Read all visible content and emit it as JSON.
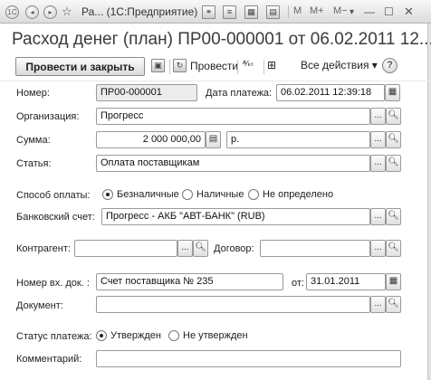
{
  "titlebar": {
    "app_icon": "1c-logo-icon",
    "title": "Ра...  (1С:Предприятие)",
    "memory_buttons": [
      "M",
      "M+",
      "M−"
    ]
  },
  "doc_title": "Расход денег (план) ПР00-000001 от 06.02.2011 12...",
  "toolbar": {
    "post_close": "Провести и закрыть",
    "post": "Провести",
    "all_actions": "Все действия ▾",
    "help": "?"
  },
  "form": {
    "number_label": "Номер:",
    "number_value": "ПР00-000001",
    "pay_date_label": "Дата платежа:",
    "pay_date_value": "06.02.2011 12:39:18",
    "org_label": "Организация:",
    "org_value": "Прогресс",
    "sum_label": "Сумма:",
    "sum_value": "2 000 000,00",
    "currency_value": "р.",
    "article_label": "Статья:",
    "article_value": "Оплата поставщикам",
    "pay_method_label": "Способ оплаты:",
    "pay_methods": [
      "Безналичные",
      "Наличные",
      "Не определено"
    ],
    "bank_label": "Банковский счет:",
    "bank_value": "Прогресс - АКБ \"АВТ-БАНК\" (RUB)",
    "counterparty_label": "Контрагент:",
    "counterparty_value": "",
    "contract_label": "Договор:",
    "contract_value": "",
    "in_doc_label": "Номер вх. док. :",
    "in_doc_value": "Счет поставщика № 235",
    "from_label": "от:",
    "from_value": "31.01.2011",
    "document_label": "Документ:",
    "document_value": "",
    "status_label": "Статус платежа:",
    "statuses": [
      "Утвержден",
      "Не утвержден"
    ],
    "comment_label": "Комментарий:",
    "comment_value": ""
  }
}
